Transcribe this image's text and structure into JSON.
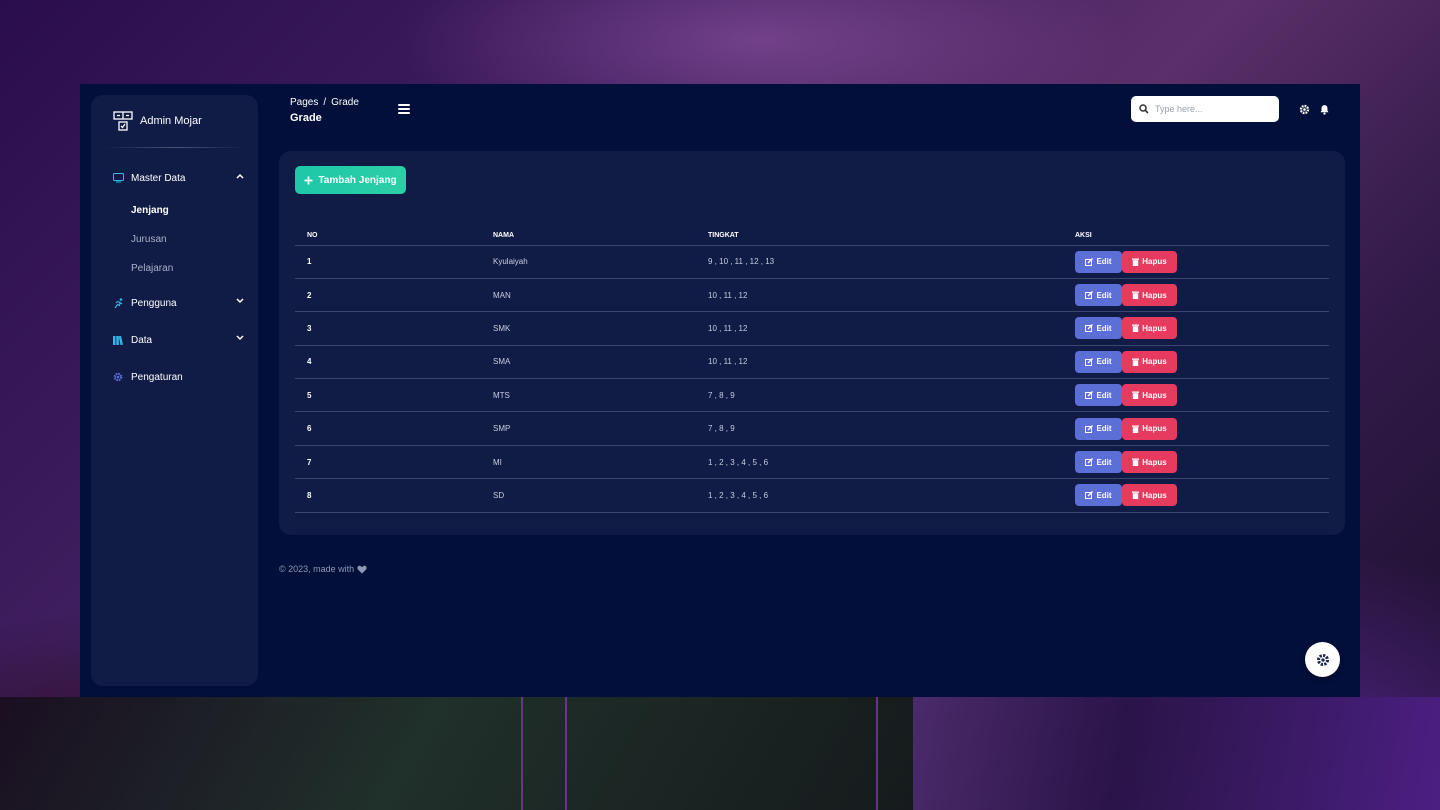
{
  "brand": {
    "name": "Admin Mojar"
  },
  "sidebar": {
    "items": [
      {
        "label": "Master Data",
        "icon": "monitor-icon",
        "expanded": true,
        "children": [
          {
            "label": "Jenjang",
            "active": true
          },
          {
            "label": "Jurusan",
            "active": false
          },
          {
            "label": "Pelajaran",
            "active": false
          }
        ]
      },
      {
        "label": "Pengguna",
        "icon": "running-person-icon",
        "expanded": false
      },
      {
        "label": "Data",
        "icon": "books-icon",
        "expanded": false
      },
      {
        "label": "Pengaturan",
        "icon": "gear-icon"
      }
    ]
  },
  "header": {
    "breadcrumb": {
      "root": "Pages",
      "separator": "/",
      "current": "Grade"
    },
    "title": "Grade",
    "search_placeholder": "Type here..."
  },
  "main": {
    "add_button_label": "Tambah Jenjang",
    "table": {
      "columns": [
        "NO",
        "NAMA",
        "TINGKAT",
        "AKSI"
      ],
      "rows": [
        {
          "no": "1",
          "nama": "Kyulaiyah",
          "tingkat": "9 , 10 , 11 , 12 , 13"
        },
        {
          "no": "2",
          "nama": "MAN",
          "tingkat": "10 , 11 , 12"
        },
        {
          "no": "3",
          "nama": "SMK",
          "tingkat": "10 , 11 , 12"
        },
        {
          "no": "4",
          "nama": "SMA",
          "tingkat": "10 , 11 , 12"
        },
        {
          "no": "5",
          "nama": "MTS",
          "tingkat": "7 , 8 , 9"
        },
        {
          "no": "6",
          "nama": "SMP",
          "tingkat": "7 , 8 , 9"
        },
        {
          "no": "7",
          "nama": "MI",
          "tingkat": "1 , 2 , 3 , 4 , 5 , 6"
        },
        {
          "no": "8",
          "nama": "SD",
          "tingkat": "1 , 2 , 3 , 4 , 5 , 6"
        }
      ],
      "edit_label": "Edit",
      "delete_label": "Hapus"
    }
  },
  "footer": {
    "text": "© 2023, made with"
  },
  "colors": {
    "app_bg": "#020f3a",
    "panel_bg": "#111c46",
    "accent_green": "#1dc8a8",
    "edit_blue": "#5b6fd6",
    "delete_red": "#e63a5e"
  }
}
